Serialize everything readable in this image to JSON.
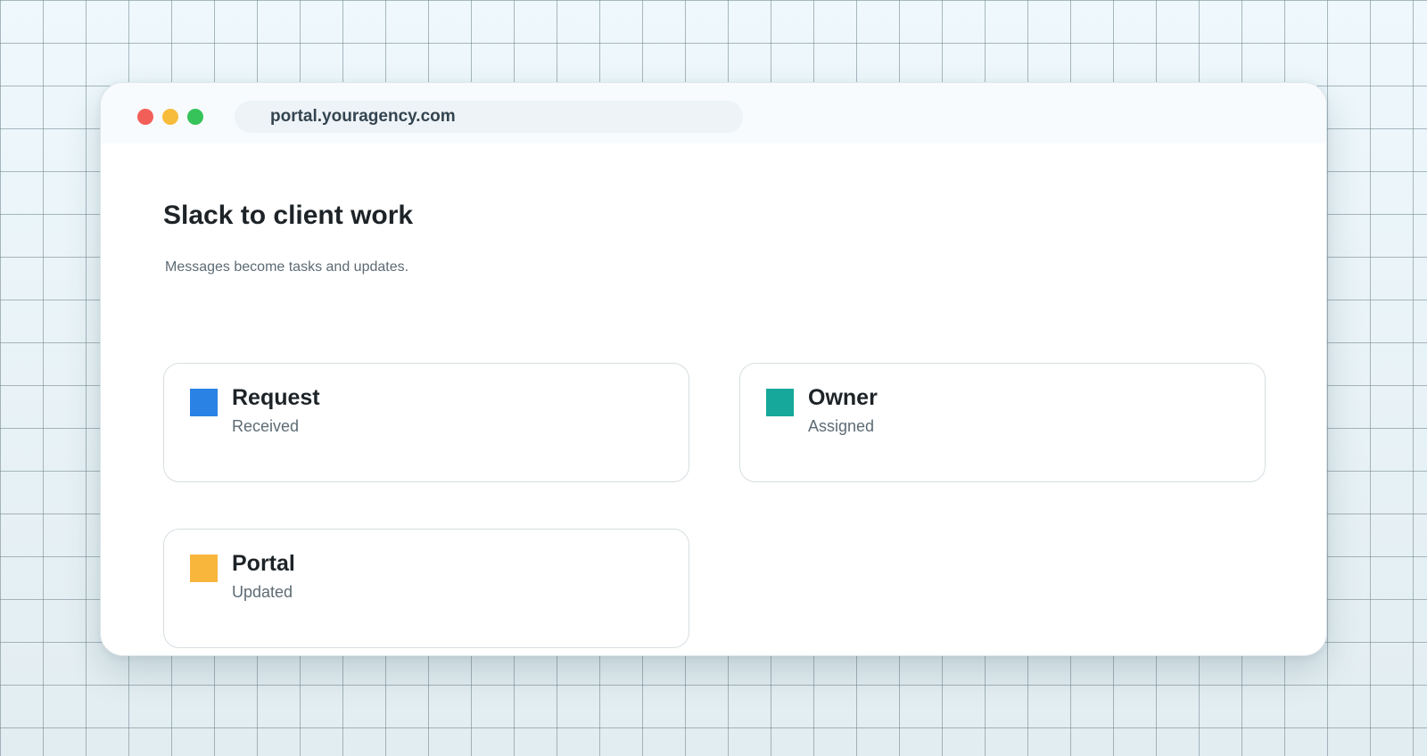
{
  "browser": {
    "url": "portal.youragency.com",
    "controls": {
      "close_color": "#f25f58",
      "minimize_color": "#f8bc3c",
      "maximize_color": "#36c45a"
    }
  },
  "page": {
    "title": "Slack to client work",
    "subtitle": "Messages become tasks and updates."
  },
  "cards": [
    {
      "title": "Request",
      "status": "Received",
      "color": "#2a82e4"
    },
    {
      "title": "Owner",
      "status": "Assigned",
      "color": "#16a89a"
    },
    {
      "title": "Portal",
      "status": "Updated",
      "color": "#f8b63d"
    }
  ]
}
